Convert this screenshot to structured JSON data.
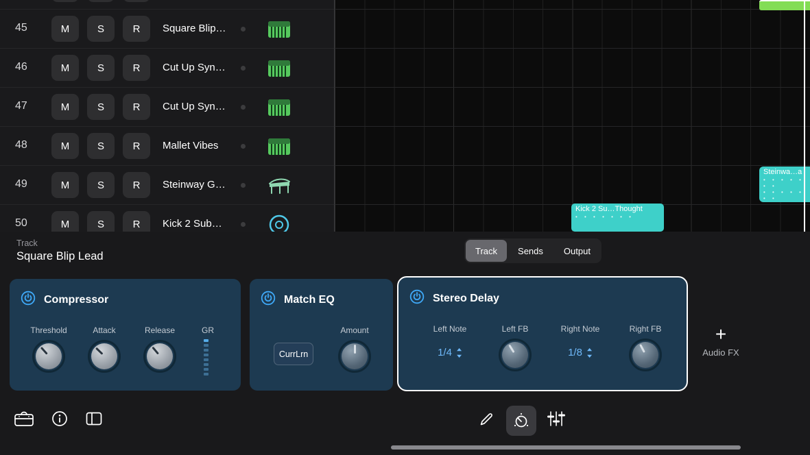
{
  "track_list": {
    "buttons": {
      "mute": "M",
      "solo": "S",
      "record": "R"
    },
    "rows": [
      {
        "num": "45",
        "name": "Square Blip…",
        "icon": "synth"
      },
      {
        "num": "46",
        "name": "Cut Up Syn…",
        "icon": "synth"
      },
      {
        "num": "47",
        "name": "Cut Up Syn…",
        "icon": "synth"
      },
      {
        "num": "48",
        "name": "Mallet Vibes",
        "icon": "synth"
      },
      {
        "num": "49",
        "name": "Steinway G…",
        "icon": "piano"
      },
      {
        "num": "50",
        "name": "Kick 2 Sub…",
        "icon": "kick"
      }
    ]
  },
  "timeline": {
    "clips": {
      "kick": "Kick 2 Su…Thought",
      "steinway": "Steinwa…a",
      "dots": "• • • • • • •"
    }
  },
  "inspector": {
    "section_label": "Track",
    "track_name": "Square Blip Lead",
    "tabs": [
      "Track",
      "Sends",
      "Output"
    ],
    "selected_tab": "Track"
  },
  "plugins": {
    "compressor": {
      "title": "Compressor",
      "labels": [
        "Threshold",
        "Attack",
        "Release",
        "GR"
      ]
    },
    "match_eq": {
      "title": "Match EQ",
      "learn_button": "CurrLrn",
      "amount_label": "Amount"
    },
    "stereo_delay": {
      "title": "Stereo Delay",
      "left_note_label": "Left Note",
      "left_note_value": "1/4",
      "left_fb_label": "Left FB",
      "right_note_label": "Right Note",
      "right_note_value": "1/8",
      "right_fb_label": "Right FB"
    },
    "add_audio_fx": {
      "plus": "+",
      "label": "Audio FX"
    }
  },
  "colors": {
    "accent_blue": "#3fa9f8",
    "clip_teal": "#3ed0c9",
    "clip_green": "#83dd55",
    "panel_blue": "#1d3a51",
    "note_value_blue": "#6fb9fa"
  }
}
